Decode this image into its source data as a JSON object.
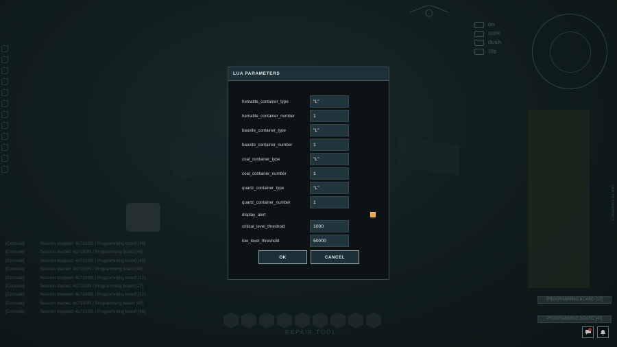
{
  "dialog": {
    "title": "LUA PARAMETERS",
    "params": [
      {
        "label": "hematite_container_type",
        "value": "\"L\""
      },
      {
        "label": "hematite_container_number",
        "value": "1"
      },
      {
        "label": "bauxite_container_type",
        "value": "\"L\""
      },
      {
        "label": "bauxite_container_number",
        "value": "1"
      },
      {
        "label": "coal_container_type",
        "value": "\"L\""
      },
      {
        "label": "coal_container_number",
        "value": "1"
      },
      {
        "label": "quartz_container_type",
        "value": "\"L\""
      },
      {
        "label": "quartz_container_number",
        "value": "1"
      },
      {
        "label": "display_alert",
        "checked": true
      },
      {
        "label": "critical_level_threshold",
        "value": "1000"
      },
      {
        "label": "low_level_threshold",
        "value": "50000"
      }
    ],
    "ok_label": "OK",
    "cancel_label": "CANCEL"
  },
  "console": {
    "lines": [
      {
        "tag": "[Console]",
        "text": "Session stopped: 4c7193f0 / Programming board [49]"
      },
      {
        "tag": "[Console]",
        "text": "Session started: 4c7193f0 / Programming board [49]"
      },
      {
        "tag": "[Console]",
        "text": "Session stopped: 4c7193f0 / Programming board [49]"
      },
      {
        "tag": "[Console]",
        "text": "Session started: 4c7193f0 / Programming board [49]"
      },
      {
        "tag": "[Console]",
        "text": "Session stopped: 4c7193f0 / Programming board [17]"
      },
      {
        "tag": "[Console]",
        "text": "Session started: 4c7193f0 / Programming board [17]"
      },
      {
        "tag": "[Console]",
        "text": "Session stopped: 4c7193f0 / Programming board [17]"
      },
      {
        "tag": "[Console]",
        "text": "Session started: 4c7193f0 / Programming board [49]"
      },
      {
        "tag": "[Console]",
        "text": "Session stopped: 4c7193f0 / Programming board [49]"
      }
    ]
  },
  "hud": {
    "stats": [
      "0m",
      "100%",
      "0km/h",
      "10g"
    ],
    "hotbar_label": "REPAIR TOOL",
    "badges": [
      "PROGRAMMING BOARD [17]",
      "PROGRAMMING BOARD [49]"
    ],
    "side_text": "LINK TO CONSTRUCT"
  },
  "icons": {
    "chat": "chat-icon",
    "notification": "bell-icon"
  },
  "colors": {
    "dialog_bg": "#0d1214",
    "header_bg": "#1e3138",
    "input_bg": "#22353d",
    "checkbox": "#e6a93e",
    "notification_dot": "#dd3333"
  }
}
